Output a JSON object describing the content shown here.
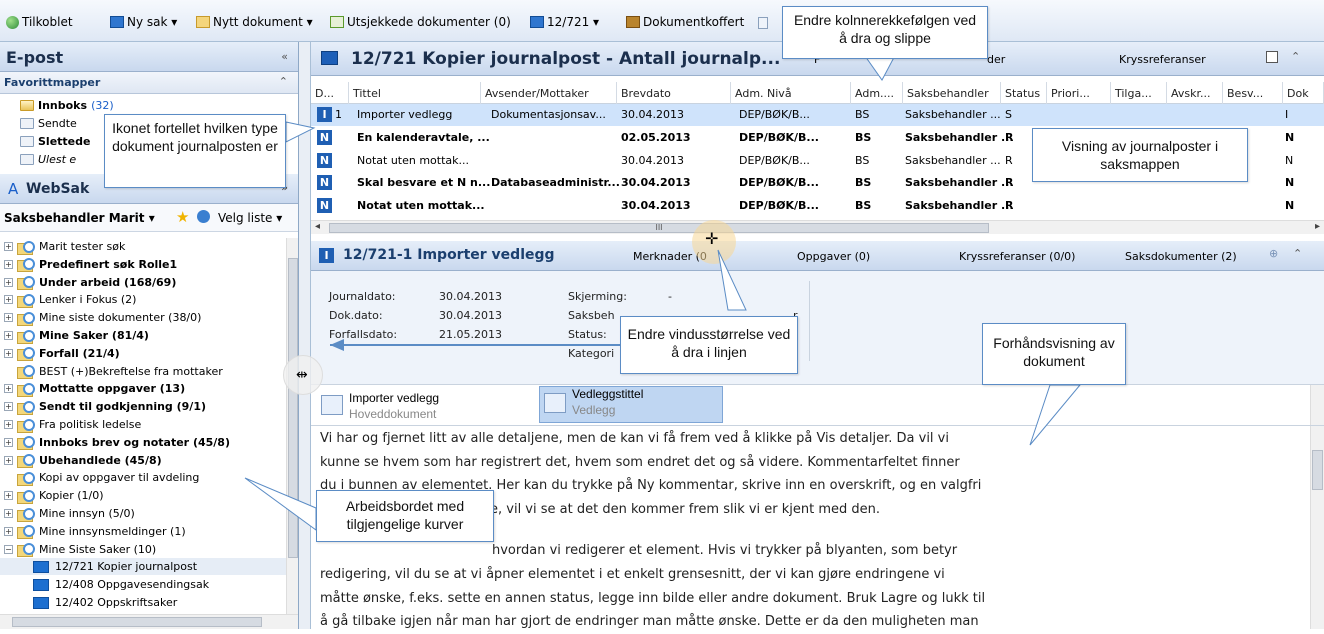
{
  "toolbar": {
    "items": [
      "Tilkoblet",
      "Ny sak ▾",
      "Nytt dokument ▾",
      "Utsjekkede dokumenter (0)",
      "12/721 ▾",
      "Dokumentkoffert"
    ]
  },
  "left": {
    "email_title": "E-post",
    "fav_title": "Favorittmapper",
    "fav_items": [
      {
        "label": "Innboks",
        "count": "(32)"
      },
      {
        "label": "Sendte",
        "count": ""
      },
      {
        "label": "Slettede",
        "count": ""
      },
      {
        "label": "Ulest e",
        "count": ""
      }
    ],
    "websak_title": "WebSak",
    "user_dropdown": "Saksbehandler Marit ▾",
    "velg_liste": "Velg liste ▾",
    "tree": [
      {
        "label": "Marit tester søk",
        "bold": false,
        "plus": true,
        "icon": "t"
      },
      {
        "label": "Predefinert søk Rolle1",
        "bold": true,
        "plus": true,
        "icon": "t"
      },
      {
        "label": "Under arbeid (168/69)",
        "bold": true,
        "plus": true,
        "icon": "t"
      },
      {
        "label": "Lenker i Fokus (2)",
        "bold": false,
        "plus": true,
        "icon": "t"
      },
      {
        "label": "Mine siste dokumenter (38/0)",
        "bold": false,
        "plus": true,
        "icon": "t"
      },
      {
        "label": "Mine Saker (81/4)",
        "bold": true,
        "plus": true,
        "icon": "t"
      },
      {
        "label": "Forfall (21/4)",
        "bold": true,
        "plus": true,
        "icon": "t"
      },
      {
        "label": "BEST (+)Bekreftelse fra mottaker",
        "bold": false,
        "plus": false,
        "icon": "t"
      },
      {
        "label": "Mottatte oppgaver (13)",
        "bold": true,
        "plus": true,
        "icon": "t"
      },
      {
        "label": "Sendt til godkjenning (9/1)",
        "bold": true,
        "plus": true,
        "icon": "t"
      },
      {
        "label": "Fra politisk ledelse",
        "bold": false,
        "plus": true,
        "icon": "t"
      },
      {
        "label": "Innboks brev og notater (45/8)",
        "bold": true,
        "plus": true,
        "icon": "t"
      },
      {
        "label": "Ubehandlede (45/8)",
        "bold": true,
        "plus": true,
        "icon": "t"
      },
      {
        "label": "Kopi av oppgaver til avdeling",
        "bold": false,
        "plus": false,
        "icon": "t"
      },
      {
        "label": "Kopier (1/0)",
        "bold": false,
        "plus": true,
        "icon": "t"
      },
      {
        "label": "Mine innsyn (5/0)",
        "bold": false,
        "plus": true,
        "icon": "t"
      },
      {
        "label": "Mine innsynsmeldinger (1)",
        "bold": false,
        "plus": true,
        "icon": "t"
      },
      {
        "label": "Mine Siste Saker (10)",
        "bold": false,
        "plus": true,
        "icon": "t"
      },
      {
        "label": "12/721 Kopier journalpost",
        "bold": false,
        "plus": false,
        "icon": "b"
      },
      {
        "label": "12/408 Oppgavesendingsak",
        "bold": false,
        "plus": false,
        "icon": "b"
      },
      {
        "label": "12/402 Oppskriftsaker",
        "bold": false,
        "plus": false,
        "icon": "b"
      }
    ]
  },
  "case": {
    "title": "12/721 Kopier journalpost - Antall journalp...",
    "tab_partial": "F",
    "tab_der": "der",
    "tab_kryss": "Kryssreferanser"
  },
  "grid": {
    "headers": [
      "D...",
      "Tittel",
      "Avsender/Mottaker",
      "Brevdato",
      "Adm. Nivå",
      "Adm....",
      "Saksbehandler",
      "Status",
      "Priori...",
      "Tilga...",
      "Avskr...",
      "Besv...",
      "Dok"
    ],
    "rows": [
      {
        "num": "1",
        "title": "Importer vedlegg",
        "avs": "Dokumentasjonsav...",
        "date": "30.04.2013",
        "niva": "DEP/BØK/B...",
        "adm": "BS",
        "sb": "Saksbehandler ...",
        "status": "S",
        "dok": "I",
        "bold": false,
        "selected": true
      },
      {
        "num": "",
        "title": "En kalenderavtale, ...",
        "avs": "",
        "date": "02.05.2013",
        "niva": "DEP/BØK/B...",
        "adm": "BS",
        "sb": "Saksbehandler ...",
        "status": "R",
        "dok": "N",
        "bold": true,
        "selected": false
      },
      {
        "num": "",
        "title": "Notat uten mottak...",
        "avs": "",
        "date": "30.04.2013",
        "niva": "DEP/BØK/B...",
        "adm": "BS",
        "sb": "Saksbehandler ...",
        "status": "R",
        "dok": "N",
        "bold": false,
        "selected": false
      },
      {
        "num": "",
        "title": "Skal besvare et N n...",
        "avs": "Databaseadministr...",
        "date": "30.04.2013",
        "niva": "DEP/BØK/B...",
        "adm": "BS",
        "sb": "Saksbehandler ...",
        "status": "R",
        "dok": "N",
        "bold": true,
        "selected": false
      },
      {
        "num": "",
        "title": "Notat uten mottak...",
        "avs": "",
        "date": "30.04.2013",
        "niva": "DEP/BØK/B...",
        "adm": "BS",
        "sb": "Saksbehandler ...",
        "status": "R",
        "dok": "N",
        "bold": true,
        "selected": false
      }
    ],
    "hscroll_mark": "III"
  },
  "journal": {
    "title": "12/721-1  Importer vedlegg",
    "tab_merknader": "Merknader (0",
    "tab_oppgaver": "Oppgaver (0)",
    "tab_kryss": "Kryssreferanser (0/0)",
    "tab_saksdok": "Saksdokumenter (2)",
    "journaldato_label": "Journaldato:",
    "journaldato": "30.04.2013",
    "dokdato_label": "Dok.dato:",
    "dokdato": "30.04.2013",
    "forfall_label": "Forfallsdato:",
    "forfall": "21.05.2013",
    "skjerming_label": "Skjerming:",
    "skjerming": "-",
    "saksbeh_label": "Saksbeh",
    "saksbeh_tail": "r",
    "status_label": "Status:",
    "kategori_label": "Kategori"
  },
  "attachments": [
    {
      "title": "Importer vedlegg",
      "sub": "Hoveddokument"
    },
    {
      "title": "Vedleggstittel",
      "sub": "Vedlegg"
    }
  ],
  "doc_text": [
    "Vi har og fjernet litt av alle detaljene, men de kan vi få frem ved å klikke på Vis detaljer. Da vil vi",
    "kunne se hvem som har registrert det, hvem som endret det og så videre. Kommentarfeltet finner",
    "du i bunnen av elementet. Her kan du trykke på Ny kommentar, skrive inn en overskrift, og en valgfri",
    "e, vil vi se at det den kommer frem slik vi er kjent med den.",
    "hvordan vi redigerer et element. Hvis vi trykker på blyanten, som betyr",
    "redigering, vil du se at vi åpner elementet i et enkelt grensesnitt, der vi kan gjøre endringene vi",
    "måtte ønske, f.eks. sette en annen status, legge inn bilde eller andre dokument. Bruk Lagre og lukk til",
    "å gå tilbake igjen når man har gjort de endringer man måtte ønske. Dette er da den muligheten man"
  ],
  "callouts": {
    "column_order": "Endre kolnnerekkefølgen ved å dra og slippe",
    "icon_type": "Ikonet fortellet hvilken type dokument journalposten er",
    "journal_view": "Visning av journalposter i saksmappen",
    "resize": "Endre vindusstørrelse ved å dra i linjen",
    "preview": "Forhåndsvisning av dokument",
    "workbench": "Arbeidsbordet med tilgjengelige kurver"
  },
  "colors": {
    "accent": "#1f5fb3",
    "selected_row": "#cfe3fb",
    "header_bg": "#dfe8f5"
  }
}
